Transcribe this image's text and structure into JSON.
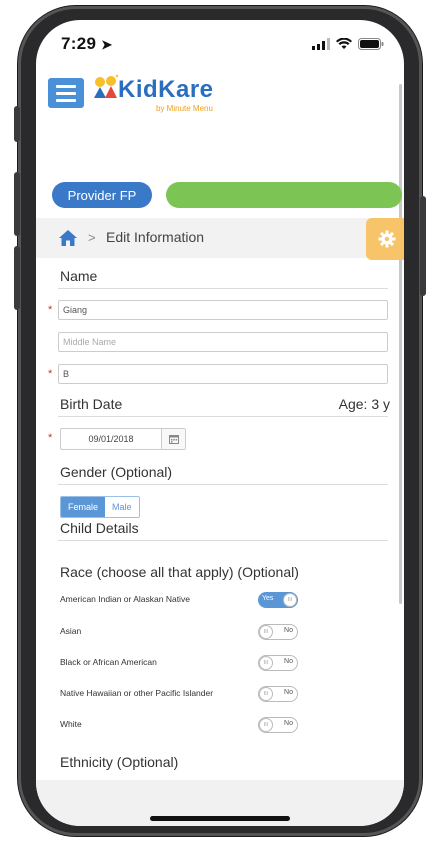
{
  "status_bar": {
    "time": "7:29"
  },
  "header": {
    "logo_text": "KidKare",
    "logo_subtitle": "by Minute Menu"
  },
  "provider": {
    "label": "Provider FP"
  },
  "progress": {
    "fraction": 1.0,
    "color": "#7cc453"
  },
  "breadcrumb": {
    "separator": ">",
    "current": "Edit Information"
  },
  "form": {
    "name_title": "Name",
    "first_name_value": "Giang",
    "middle_name_placeholder": "Middle Name",
    "last_name_value": "B",
    "required_mark": "*",
    "birth_title": "Birth Date",
    "age_label": "Age: 3 y",
    "birth_date_value": "09/01/2018",
    "gender_title": "Gender (Optional)",
    "gender_options": [
      "Female",
      "Male"
    ],
    "gender_selected": "Female",
    "child_details_title": "Child Details",
    "race_title": "Race (choose all that apply) (Optional)",
    "race_items": [
      {
        "label": "American Indian or Alaskan Native",
        "state": "Yes"
      },
      {
        "label": "Asian",
        "state": "No"
      },
      {
        "label": "Black or African American",
        "state": "No"
      },
      {
        "label": "Native Hawaiian or other Pacific Islander",
        "state": "No"
      },
      {
        "label": "White",
        "state": "No"
      }
    ],
    "toggle_yes_label": "Yes",
    "toggle_no_label": "No",
    "toggle_knob_label": "III",
    "ethnicity_title": "Ethnicity (Optional)"
  },
  "colors": {
    "primary": "#3a79c8",
    "accent": "#f7c46a",
    "success": "#7cc453"
  }
}
